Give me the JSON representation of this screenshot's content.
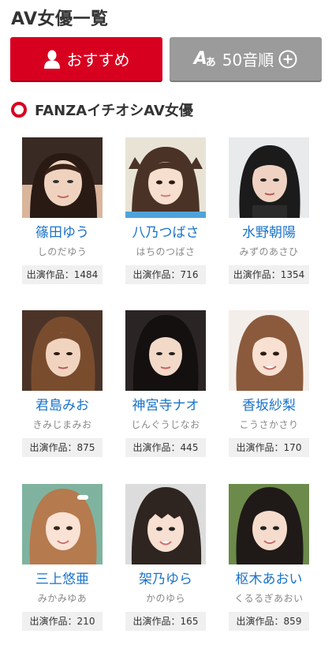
{
  "header": {
    "title": "AV女優一覧"
  },
  "tabs": {
    "recommend": {
      "label": "おすすめ",
      "icon": "person-icon",
      "color": "#d8001f"
    },
    "syllabary": {
      "label": "50音順",
      "icon_big": "A",
      "icon_small": "あ",
      "color": "#9b9b9b"
    }
  },
  "section": {
    "title": "FANZAイチオシAV女優",
    "accent": "#d8001f"
  },
  "works_prefix": "出演作品：",
  "actresses": [
    {
      "name": "篠田ゆう",
      "kana": "しのだゆう",
      "works": "1484"
    },
    {
      "name": "八乃つばさ",
      "kana": "はちのつばさ",
      "works": "716"
    },
    {
      "name": "水野朝陽",
      "kana": "みずのあさひ",
      "works": "1354"
    },
    {
      "name": "君島みお",
      "kana": "きみじまみお",
      "works": "875"
    },
    {
      "name": "神宮寺ナオ",
      "kana": "じんぐうじなお",
      "works": "445"
    },
    {
      "name": "香坂紗梨",
      "kana": "こうさかさり",
      "works": "170"
    },
    {
      "name": "三上悠亜",
      "kana": "みかみゆあ",
      "works": "210"
    },
    {
      "name": "架乃ゆら",
      "kana": "かのゆら",
      "works": "165"
    },
    {
      "name": "枢木あおい",
      "kana": "くるるぎあおい",
      "works": "859"
    }
  ]
}
